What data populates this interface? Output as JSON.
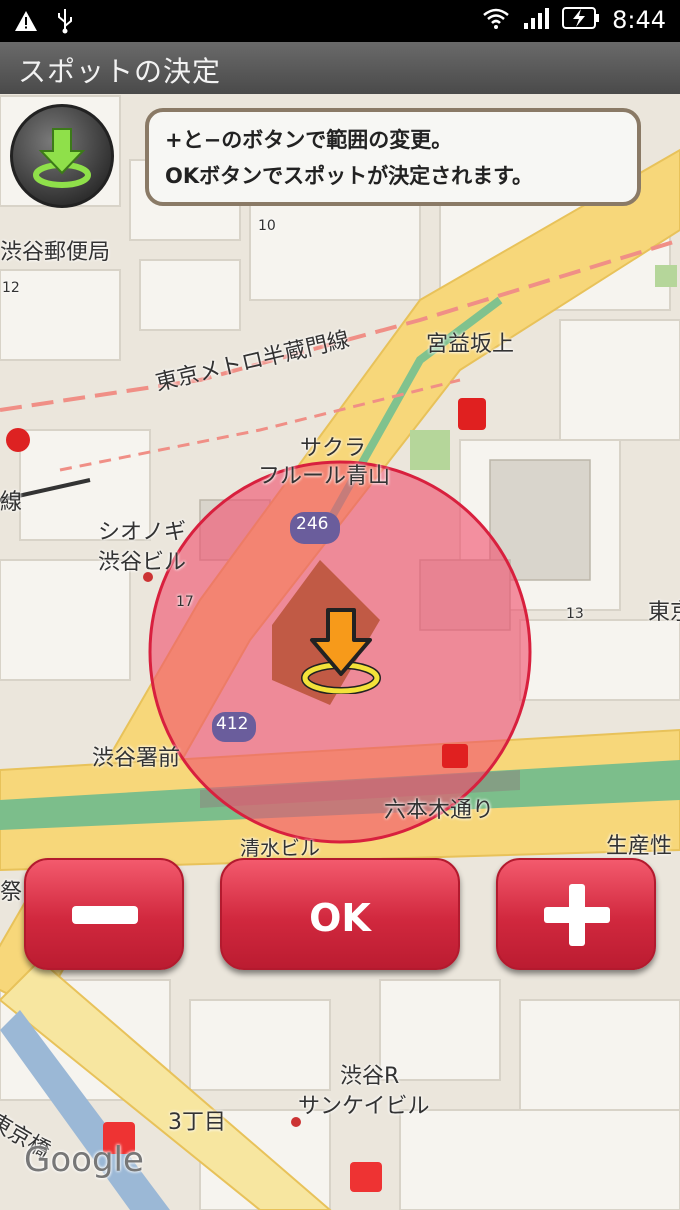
{
  "status_bar": {
    "time": "8:44"
  },
  "title_bar": {
    "title": "スポットの決定"
  },
  "help": {
    "line1": "+と−のボタンで範囲の変更。",
    "line2": "OKボタンでスポットが決定されます。"
  },
  "map": {
    "labels": {
      "post_office": "渋谷郵便局",
      "hanzomon_line": "東京メトロ半蔵門線",
      "miyamasuzaka": "宮益坂上",
      "sakura": "サクラ",
      "fleur": "フルール青山",
      "shioneki": "シオノギ",
      "shibuya_bldg": "渋谷ビル",
      "police": "渋谷署前",
      "roppongi": "六本木通り",
      "seisanse": "生産性",
      "shibuya_r": "渋谷R",
      "sankei": "サンケイビル",
      "sanchome": "3丁目",
      "higashi_bashi": "東京橋",
      "higashi": "東京",
      "shimizu": "清水ビル",
      "sen": "線",
      "sai": "祭",
      "google": "Google",
      "route_246": "246",
      "route_412": "412",
      "num_10": "10",
      "num_12": "12",
      "num_17": "17",
      "num_13": "13"
    },
    "spot_radius_note": ""
  },
  "buttons": {
    "minus": "−",
    "ok": "OK",
    "plus": "+"
  },
  "colors": {
    "accent": "#d1283e",
    "circle": "#f0506e"
  }
}
